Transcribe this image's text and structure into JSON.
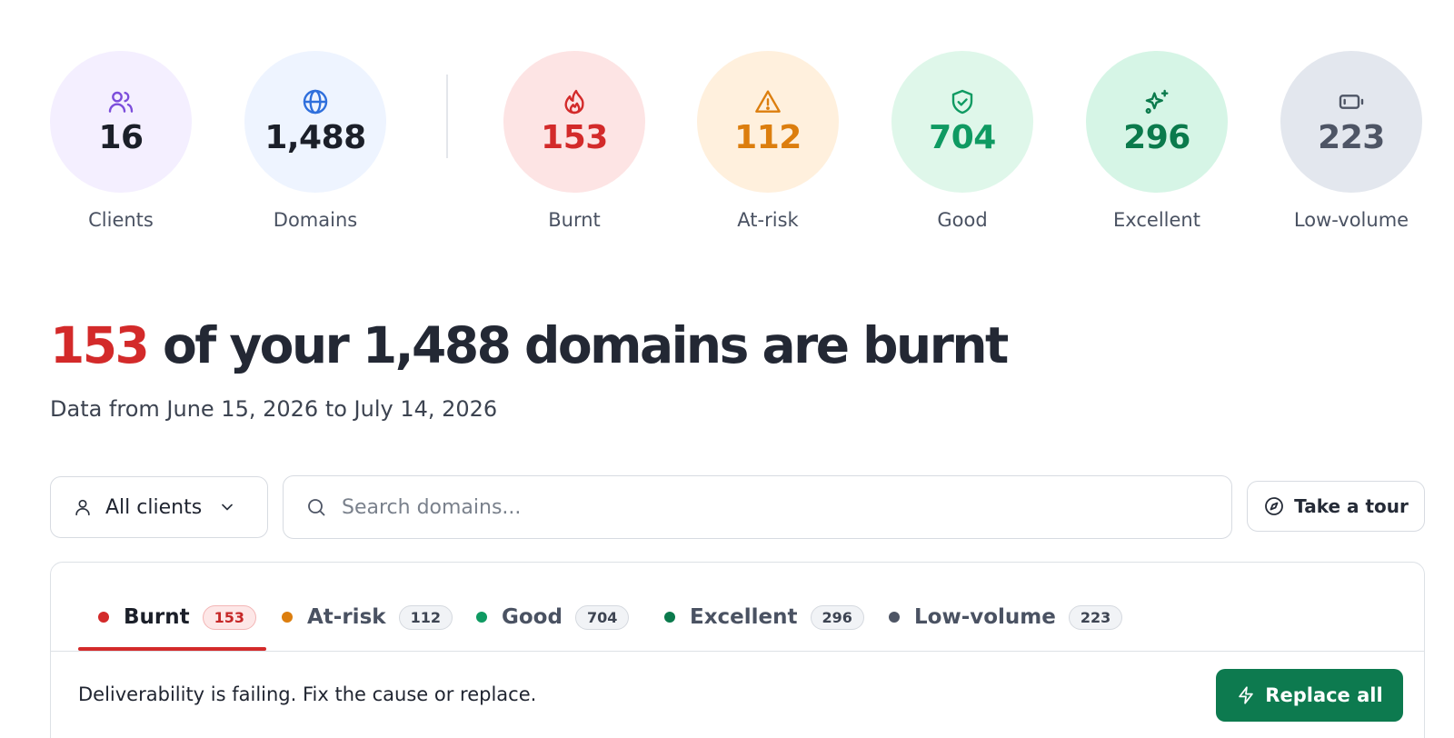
{
  "stats": {
    "clients": {
      "value": "16",
      "label": "Clients",
      "icon": "users-icon",
      "color": "#7c4ddb",
      "bg": "#f4efff"
    },
    "domains": {
      "value": "1,488",
      "label": "Domains",
      "icon": "globe-icon",
      "color": "#2f6fdc",
      "bg": "#eef4ff"
    },
    "burnt": {
      "value": "153",
      "label": "Burnt",
      "icon": "flame-icon",
      "color": "#d32a2a",
      "bg": "#fde4e4"
    },
    "at_risk": {
      "value": "112",
      "label": "At-risk",
      "icon": "alert-triangle-icon",
      "color": "#dc7e0e",
      "bg": "#fff0dd"
    },
    "good": {
      "value": "704",
      "label": "Good",
      "icon": "shield-check-icon",
      "color": "#0f9a62",
      "bg": "#dff7ea"
    },
    "excellent": {
      "value": "296",
      "label": "Excellent",
      "icon": "sparkles-icon",
      "color": "#0b7a4c",
      "bg": "#d6f5e6"
    },
    "low_volume": {
      "value": "223",
      "label": "Low-volume",
      "icon": "battery-low-icon",
      "color": "#4e5565",
      "bg": "#e3e7ee"
    }
  },
  "headline": {
    "count": "153",
    "rest": " of your 1,488 domains are burnt"
  },
  "subline": "Data from June 15, 2026 to July 14, 2026",
  "controls": {
    "client_select": {
      "label": "All clients",
      "icon": "user-icon",
      "chevron": "chevron-down-icon"
    },
    "search": {
      "placeholder": "Search domains...",
      "value": "",
      "icon": "search-icon"
    },
    "tour": {
      "label": "Take a tour",
      "icon": "compass-icon"
    }
  },
  "tabs": [
    {
      "label": "Burnt",
      "count": "153",
      "dot": "#d32a2a",
      "active": true
    },
    {
      "label": "At-risk",
      "count": "112",
      "dot": "#dc7e0e",
      "active": false
    },
    {
      "label": "Good",
      "count": "704",
      "dot": "#0f9a62",
      "active": false
    },
    {
      "label": "Excellent",
      "count": "296",
      "dot": "#0b7a4c",
      "active": false
    },
    {
      "label": "Low-volume",
      "count": "223",
      "dot": "#4e5565",
      "active": false
    }
  ],
  "panel": {
    "message": "Deliverability is failing. Fix the cause or replace.",
    "replace_button": {
      "label": "Replace all",
      "icon": "lightning-icon"
    }
  }
}
